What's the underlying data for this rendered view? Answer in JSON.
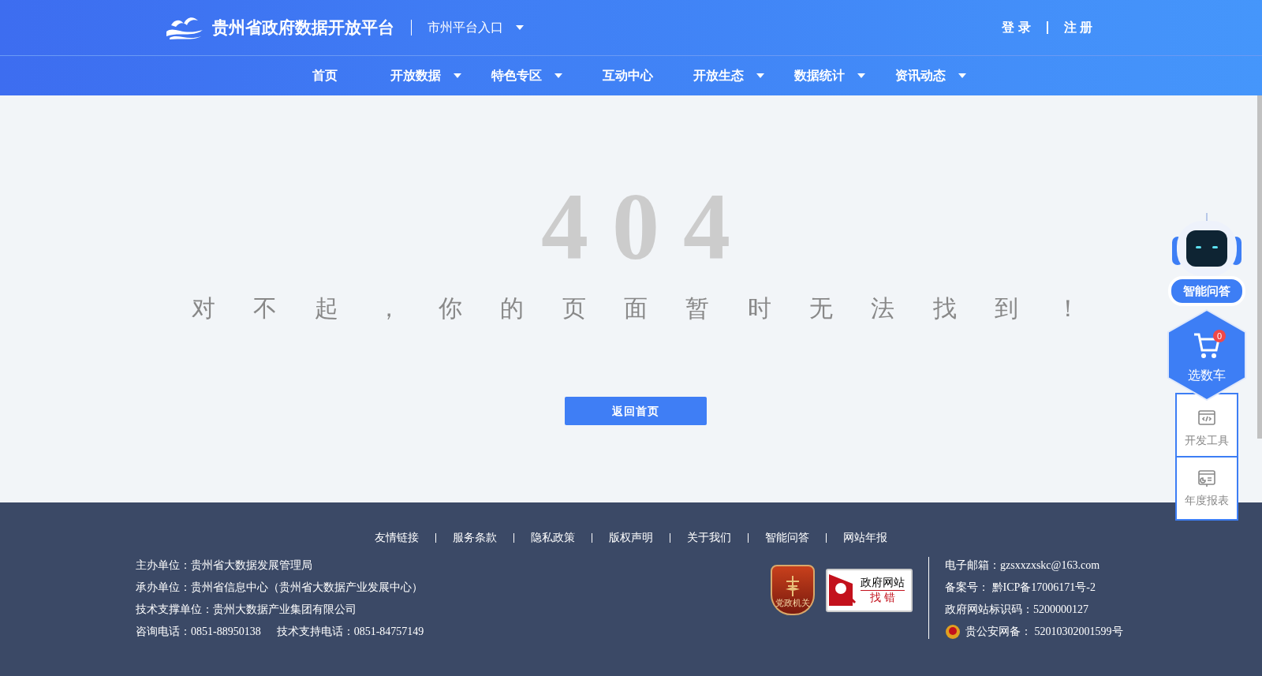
{
  "header": {
    "site_title": "贵州省政府数据开放平台",
    "city_entry": "市州平台入口",
    "auth_links": [
      "登 录",
      "注 册"
    ]
  },
  "nav": [
    {
      "label": "首页",
      "dropdown": false
    },
    {
      "label": "开放数据",
      "dropdown": true
    },
    {
      "label": "特色专区",
      "dropdown": true
    },
    {
      "label": "互动中心",
      "dropdown": false
    },
    {
      "label": "开放生态",
      "dropdown": true
    },
    {
      "label": "数据统计",
      "dropdown": true
    },
    {
      "label": "资讯动态",
      "dropdown": true
    }
  ],
  "error": {
    "code": "404",
    "message": "对 不 起 ， 你 的 页 面 暂 时 无 法 找 到 ！",
    "button": "返回首页"
  },
  "float_panel": {
    "assistant": "智能问答",
    "cart": {
      "label": "选数车",
      "count": "0"
    },
    "tools": [
      "开发工具",
      "年度报表"
    ]
  },
  "footer": {
    "links": [
      "友情链接",
      "服务条款",
      "隐私政策",
      "版权声明",
      "关于我们",
      "智能问答",
      "网站年报"
    ],
    "left_lines": [
      "主办单位：贵州省大数据发展管理局",
      "承办单位：贵州省信息中心（贵州省大数据产业发展中心）",
      "技术支撑单位：贵州大数据产业集团有限公司"
    ],
    "phones": [
      "咨询电话：0851-88950138",
      "技术支持电话：0851-84757149"
    ],
    "party_badge": "党政机关",
    "report_badge": {
      "title": "政府网站",
      "action": "找 错"
    },
    "right_lines": [
      "电子邮箱：gzsxxzxskc@163.com",
      "备案号： 黔ICP备17006171号-2",
      "政府网站标识码：5200000127"
    ],
    "police_record": "贵公安网备： 52010302001599号"
  }
}
